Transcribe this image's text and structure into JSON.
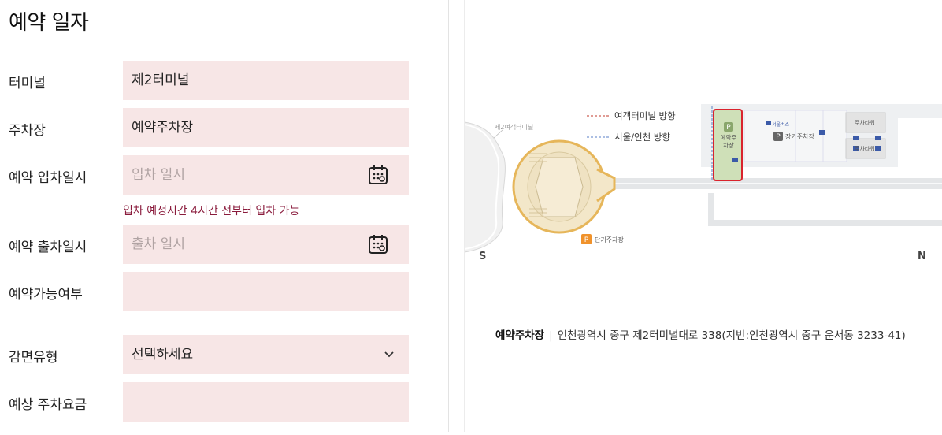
{
  "form": {
    "title": "예약 일자",
    "terminal": {
      "label": "터미널",
      "value": "제2터미널"
    },
    "parking_lot": {
      "label": "주차장",
      "value": "예약주차장"
    },
    "entry": {
      "label": "예약 입차일시",
      "placeholder": "입차 일시",
      "hint": "입차 예정시간 4시간 전부터 입차 가능"
    },
    "exit": {
      "label": "예약 출차일시",
      "placeholder": "출차 일시"
    },
    "availability": {
      "label": "예약가능여부",
      "value": ""
    },
    "discount": {
      "label": "감면유형",
      "selected": "선택하세요"
    },
    "fee": {
      "label": "예상 주차요금",
      "value": ""
    }
  },
  "map": {
    "legend": {
      "passenger_terminal": "여객터미널 방향",
      "seoul_incheon": "서울/인천 방향"
    },
    "terminal_label": "제2여객터미널",
    "reserved_lot": "예약주차장",
    "reserved_lot_p": "P",
    "long_term_lot": "장기주차장",
    "short_term_lot": "단기주차장",
    "parking_tower_1": "주차타워",
    "parking_tower_2": "주차타워",
    "seoul_bus": "서울버스",
    "compass_s": "S",
    "compass_n": "N",
    "address_name": "예약주차장",
    "address": "인천광역시 중구 제2터미널대로 338(지번:인천광역시 중구 운서동 3233-41)",
    "colors": {
      "reserved_border": "#d9232d",
      "reserved_fill": "#cfe0b8",
      "terminal_fill": "#f3e7c9",
      "terminal_stroke": "#e6b65a",
      "road": "#e4e6e8",
      "p_orange": "#f0922b"
    }
  }
}
